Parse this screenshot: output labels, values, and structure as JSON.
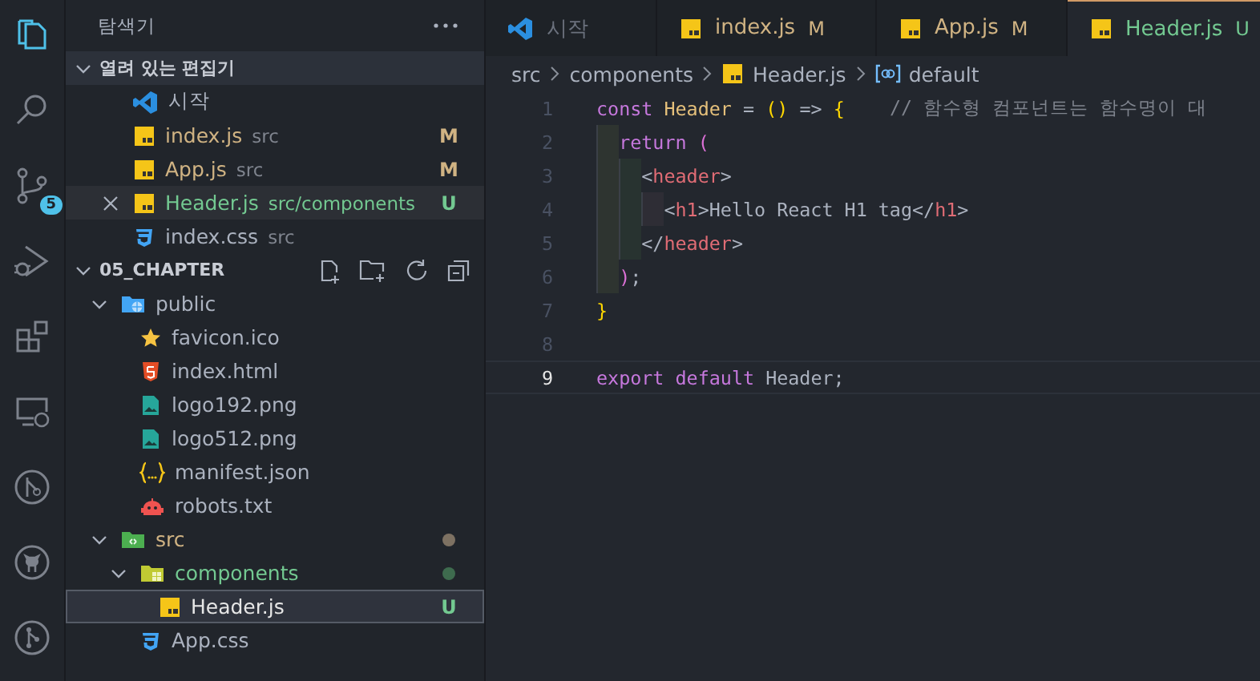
{
  "activity_bar": {
    "items": [
      {
        "kind": "explorer",
        "selected": true
      },
      {
        "kind": "search",
        "selected": false
      },
      {
        "kind": "source-control",
        "selected": false,
        "badge": "5"
      },
      {
        "kind": "run-debug",
        "selected": false
      },
      {
        "kind": "extensions",
        "selected": false
      },
      {
        "kind": "remote",
        "selected": false
      },
      {
        "kind": "timeline",
        "selected": false
      },
      {
        "kind": "github",
        "selected": false
      },
      {
        "kind": "git-graph",
        "selected": false
      }
    ]
  },
  "explorer": {
    "title": "탐색기",
    "open_editors": {
      "title": "열려 있는 편집기",
      "expanded": true,
      "items": [
        {
          "kind": "vscode",
          "name": "시작",
          "selected": false
        },
        {
          "kind": "js",
          "name": "index.js",
          "description": "src",
          "badge": "M",
          "color": "#d0b383",
          "selected": false
        },
        {
          "kind": "js",
          "name": "App.js",
          "description": "src",
          "badge": "M",
          "color": "#d0b383",
          "selected": false
        },
        {
          "kind": "js",
          "name": "Header.js",
          "description": "src/components",
          "badge": "U",
          "color": "#73c991",
          "selected": true
        },
        {
          "kind": "css",
          "name": "index.css",
          "description": "src",
          "selected": false
        }
      ]
    },
    "folder": {
      "title": "05_CHAPTER",
      "expanded": true,
      "tree": [
        {
          "kind": "folder-public",
          "name": "public",
          "expanded": true,
          "selected": false,
          "children": [
            {
              "kind": "star",
              "name": "favicon.ico",
              "selected": false
            },
            {
              "kind": "html",
              "name": "index.html",
              "selected": false
            },
            {
              "kind": "image",
              "name": "logo192.png",
              "selected": false
            },
            {
              "kind": "image",
              "name": "logo512.png",
              "selected": false
            },
            {
              "kind": "json",
              "name": "manifest.json",
              "selected": false
            },
            {
              "kind": "robot",
              "name": "robots.txt",
              "selected": false
            }
          ]
        },
        {
          "kind": "folder-src",
          "name": "src",
          "color": "#d0b383",
          "status_dot": {
            "color": "#7d7162"
          },
          "expanded": true,
          "selected": false,
          "children": [
            {
              "kind": "folder-components",
              "name": "components",
              "color": "#73c991",
              "status_dot": {
                "color": "#3e6b4e"
              },
              "expanded": true,
              "selected": false,
              "children": [
                {
                  "kind": "js",
                  "name": "Header.js",
                  "badge": "U",
                  "color": "#73c991",
                  "selected": true
                }
              ]
            },
            {
              "kind": "css",
              "name": "App.css",
              "selected": false
            }
          ]
        }
      ]
    }
  },
  "tabs": [
    {
      "kind": "vscode",
      "label": "시작",
      "selected": false
    },
    {
      "kind": "js",
      "label": "index.js",
      "badge": "M",
      "color": "#d0b383",
      "selected": false
    },
    {
      "kind": "js",
      "label": "App.js",
      "badge": "M",
      "color": "#d0b383",
      "selected": false
    },
    {
      "kind": "js",
      "label": "Header.js",
      "badge": "U",
      "color": "#73c991",
      "selected": true
    }
  ],
  "breadcrumb": [
    {
      "label": "src"
    },
    {
      "label": "components"
    },
    {
      "label": "Header.js",
      "kind": "js"
    },
    {
      "label": "default",
      "kind": "symbol"
    }
  ],
  "editor": {
    "lines": [
      {
        "number": "1",
        "current": false,
        "tokens": [
          {
            "text": "const",
            "kind": "keyword"
          },
          {
            "text": " Header",
            "kind": "name"
          },
          {
            "text": " = "
          },
          {
            "text": "()",
            "kind": "bracket1"
          },
          {
            "text": " => "
          },
          {
            "text": "{",
            "kind": "bracket1"
          },
          {
            "text": "    // 함수형 컴포넌트는 함수명이 대",
            "kind": "comment"
          }
        ]
      },
      {
        "number": "2",
        "current": false,
        "tokens": [
          {
            "text": "  return",
            "kind": "keyword"
          },
          {
            "text": " (",
            "kind": "bracket2"
          }
        ]
      },
      {
        "number": "3",
        "current": false,
        "tokens": [
          {
            "text": "    <"
          },
          {
            "text": "header",
            "kind": "tag"
          },
          {
            "text": ">"
          }
        ]
      },
      {
        "number": "4",
        "current": false,
        "tokens": [
          {
            "text": "      <"
          },
          {
            "text": "h1",
            "kind": "tag"
          },
          {
            "text": ">Hello React H1 tag</"
          },
          {
            "text": "h1",
            "kind": "tag"
          },
          {
            "text": ">"
          }
        ]
      },
      {
        "number": "5",
        "current": false,
        "tokens": [
          {
            "text": "    </"
          },
          {
            "text": "header",
            "kind": "tag"
          },
          {
            "text": ">"
          }
        ]
      },
      {
        "number": "6",
        "current": false,
        "tokens": [
          {
            "text": "  )",
            "kind": "bracket2"
          },
          {
            "text": ";"
          }
        ]
      },
      {
        "number": "7",
        "current": false,
        "tokens": [
          {
            "text": "}",
            "kind": "bracket1"
          }
        ]
      },
      {
        "number": "8",
        "current": false
      },
      {
        "number": "9",
        "current": true,
        "tokens": [
          {
            "text": "export",
            "kind": "keyword"
          },
          {
            "text": " default",
            "kind": "keyword"
          },
          {
            "text": " Header;"
          }
        ]
      }
    ]
  }
}
